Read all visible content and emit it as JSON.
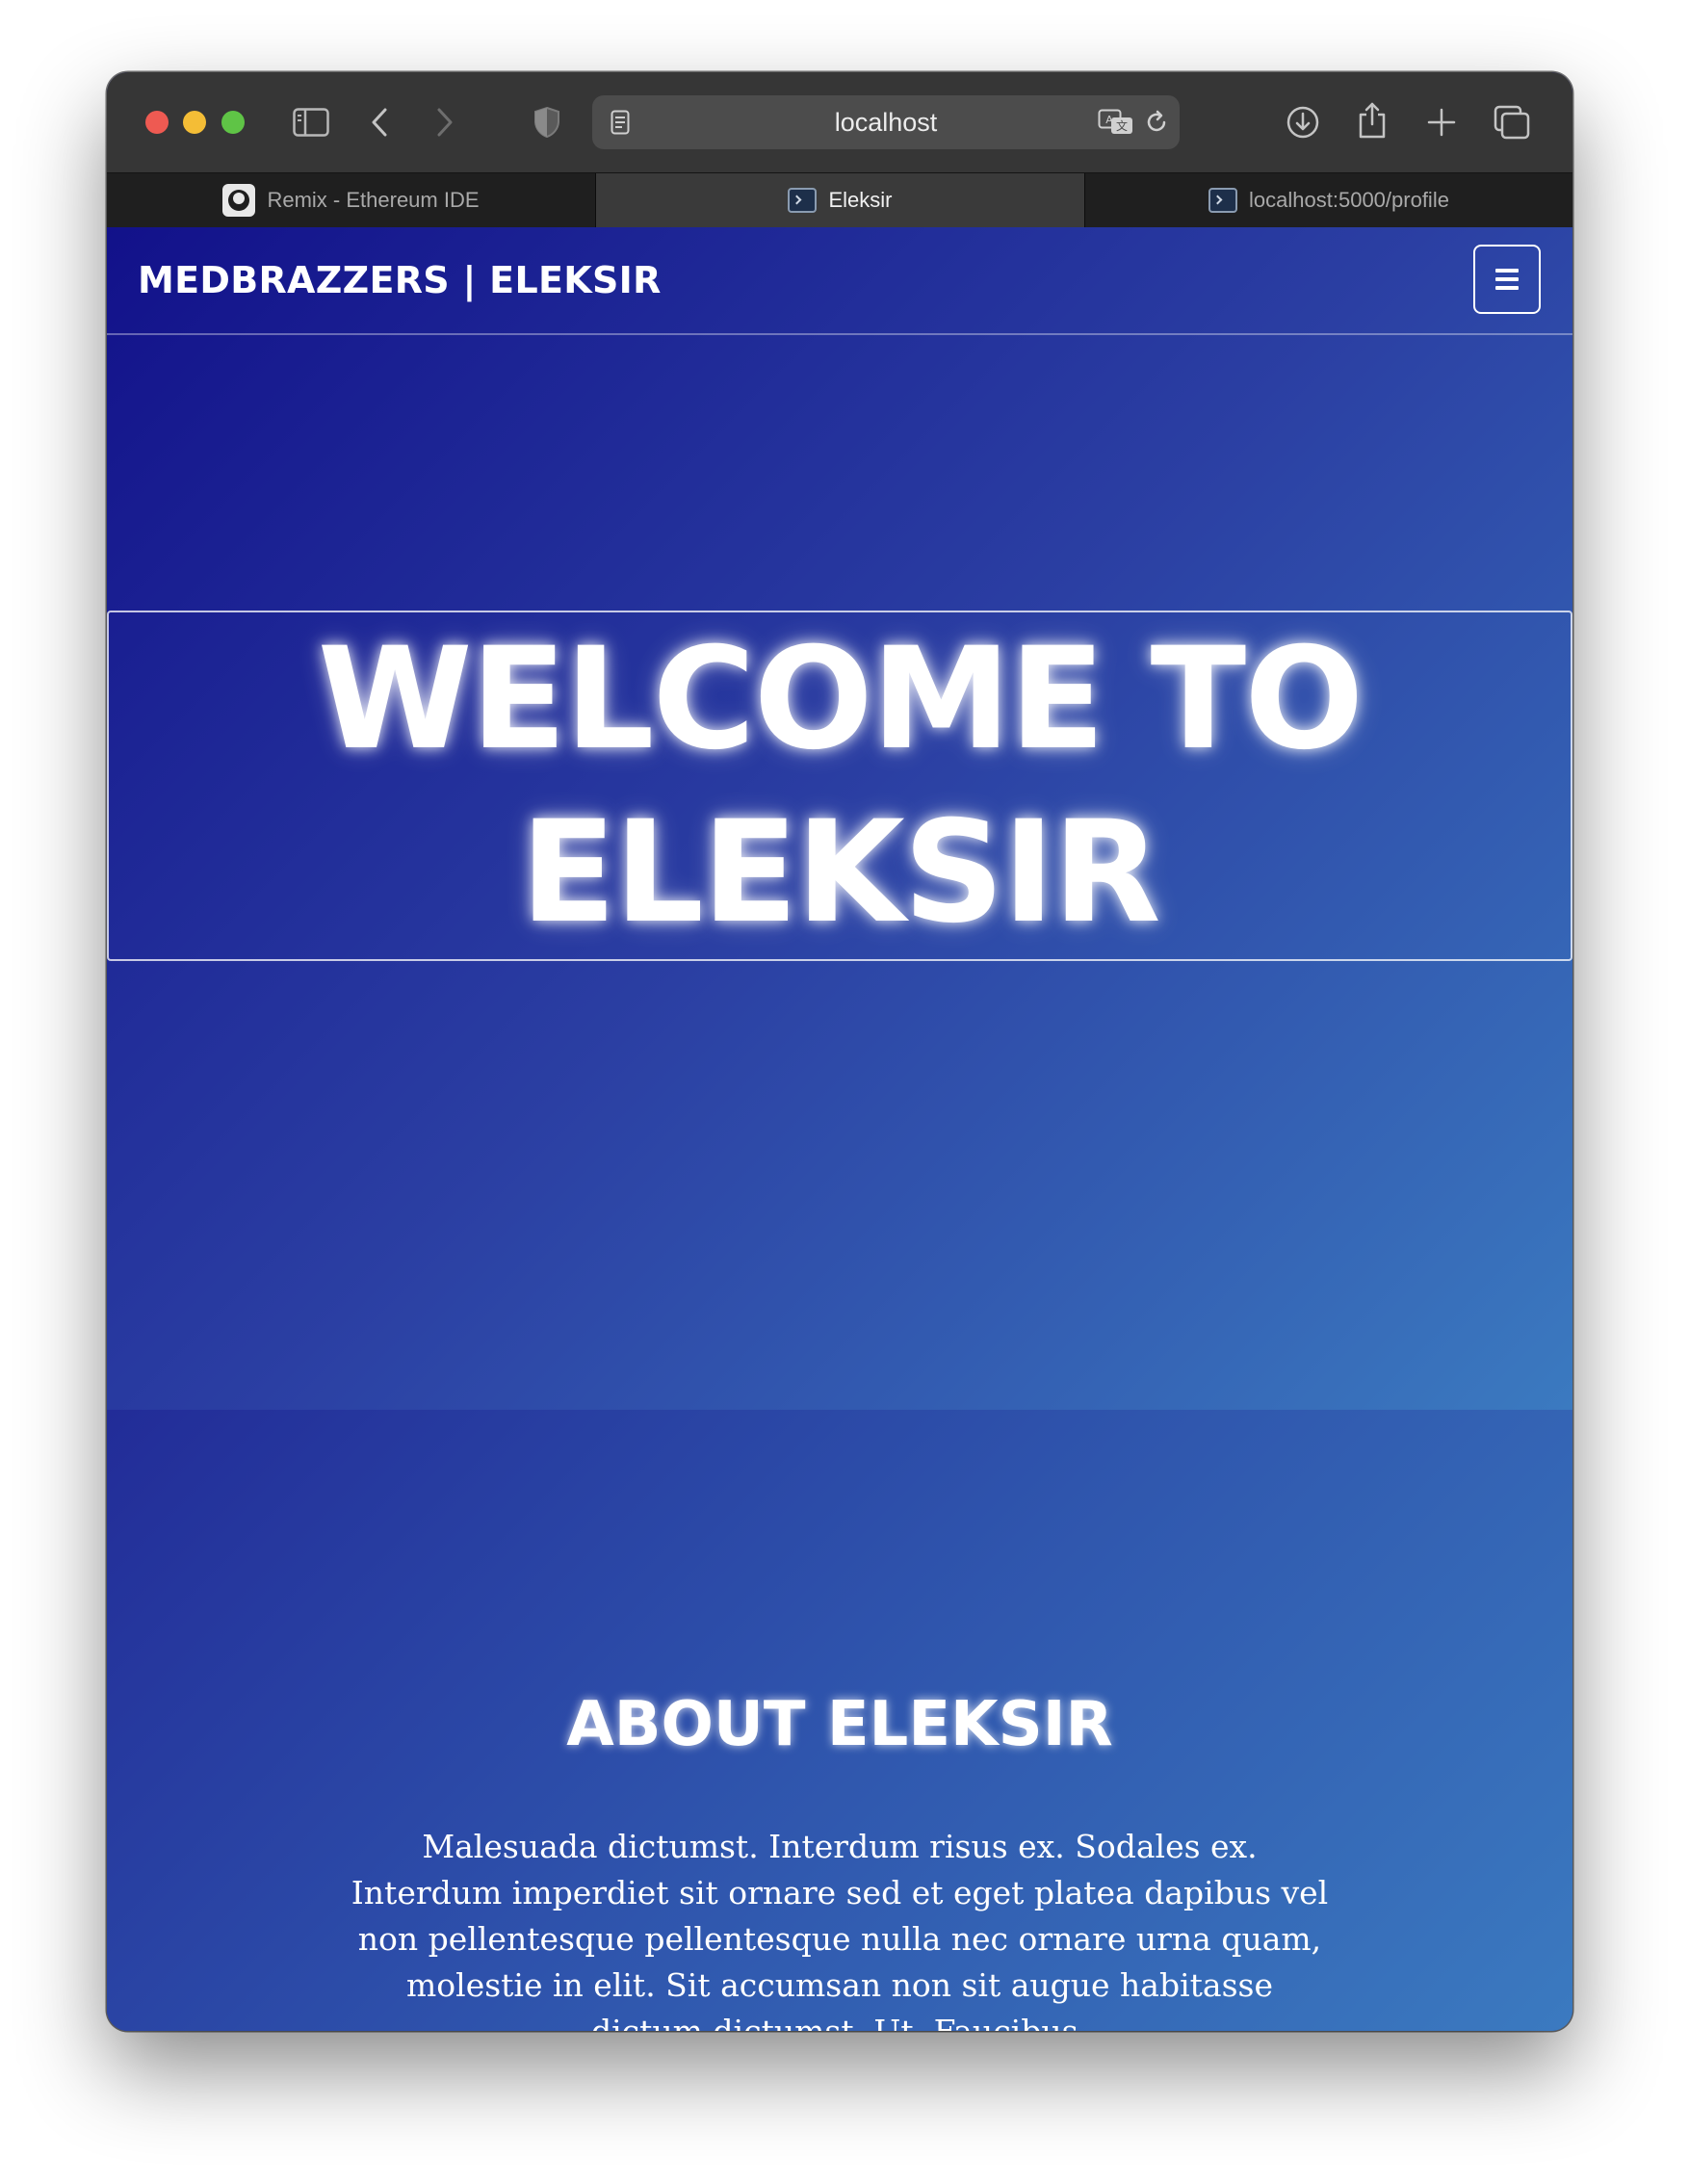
{
  "browser": {
    "url": "localhost",
    "tabs": [
      {
        "title": "Remix - Ethereum IDE",
        "active": false,
        "favicon": "remix-logo-icon"
      },
      {
        "title": "Eleksir",
        "active": true,
        "favicon": "terminal-icon"
      },
      {
        "title": "localhost:5000/profile",
        "active": false,
        "favicon": "terminal-icon"
      }
    ]
  },
  "navbar": {
    "brand": "MEDBRAZZERS | ELEKSIR",
    "menu_icon": "hamburger-icon"
  },
  "hero": {
    "title": "WELCOME TO ELEKSIR"
  },
  "about": {
    "title": "ABOUT ELEKSIR",
    "text": "Malesuada dictumst. Interdum risus ex. Sodales ex. Interdum imperdiet sit ornare sed et eget platea dapibus vel non pellentesque pellentesque nulla nec ornare urna quam, molestie in elit. Sit accumsan non sit augue habitasse dictum dictumst. Ut. Faucibus."
  },
  "colors": {
    "gradient_start": "#12118a",
    "gradient_end": "#3b7ac0",
    "text": "#ffffff"
  }
}
